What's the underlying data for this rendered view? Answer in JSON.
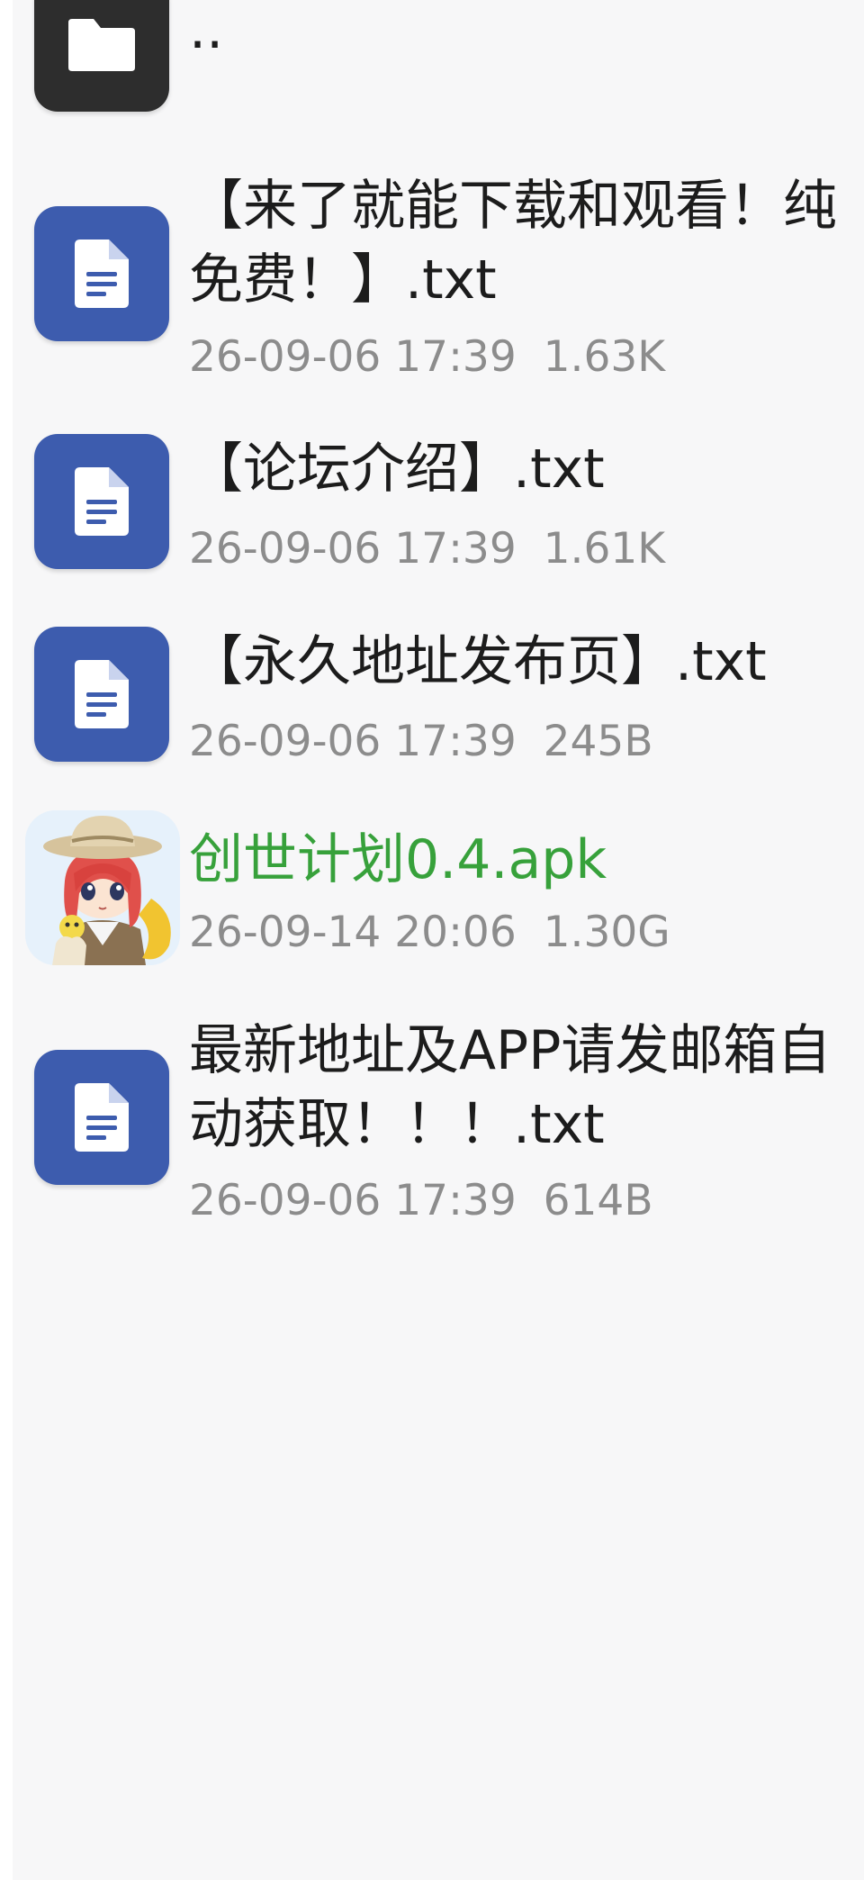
{
  "file_list": {
    "parent_dir": {
      "label": "..",
      "icon": "folder-icon"
    },
    "items": [
      {
        "name": "【来了就能下载和观看！纯免费！】.txt",
        "date": "26-09-06 17:39",
        "size": "1.63K",
        "icon": "text-file-icon"
      },
      {
        "name": "【论坛介绍】.txt",
        "date": "26-09-06 17:39",
        "size": "1.61K",
        "icon": "text-file-icon"
      },
      {
        "name": "【永久地址发布页】.txt",
        "date": "26-09-06 17:39",
        "size": "245B",
        "icon": "text-file-icon"
      },
      {
        "name": "创世计划0.4.apk",
        "date": "26-09-14 20:06",
        "size": "1.30G",
        "icon": "app-icon",
        "name_color": "#37a13b"
      },
      {
        "name": "最新地址及APP请发邮箱自动获取！！！.txt",
        "date": "26-09-06 17:39",
        "size": "614B",
        "icon": "text-file-icon"
      }
    ]
  },
  "colors": {
    "background": "#f7f7f8",
    "doc_icon": "#3d5cae",
    "folder_icon": "#2d2d2d",
    "meta_text": "#8c8c8c",
    "apk_name": "#37a13b"
  }
}
